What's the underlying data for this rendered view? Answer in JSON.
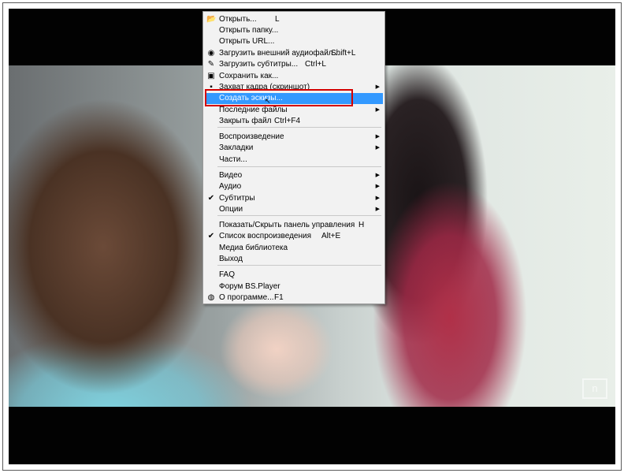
{
  "menu": {
    "items": [
      {
        "label": "Открыть...",
        "shortcut": "L",
        "icon": "open-folder-icon",
        "glyph": "📂"
      },
      {
        "label": "Открыть папку..."
      },
      {
        "label": "Открыть URL..."
      },
      {
        "label": "Загрузить внешний аудиофайл...",
        "shortcut": "Shift+L",
        "icon": "audio-file-icon",
        "glyph": "◉"
      },
      {
        "label": "Загрузить субтитры...",
        "shortcut": "Ctrl+L",
        "icon": "subtitles-pen-icon",
        "glyph": "✎"
      },
      {
        "label": "Сохранить как...",
        "icon": "save-disk-icon",
        "glyph": "▣"
      },
      {
        "label": "Захват кадра (скриншот)",
        "submenu": true,
        "icon": "camera-icon",
        "glyph": "▪"
      },
      {
        "label": "Создать эскизы...",
        "highlighted": true
      },
      {
        "label": "Последние файлы",
        "submenu": true
      },
      {
        "label": "Закрыть файл",
        "shortcut": "Ctrl+F4"
      },
      {
        "label": "Воспроизведение",
        "submenu": true
      },
      {
        "label": "Закладки",
        "submenu": true
      },
      {
        "label": "Части..."
      },
      {
        "label": "Видео",
        "submenu": true
      },
      {
        "label": "Аудио",
        "submenu": true
      },
      {
        "label": "Субтитры",
        "submenu": true,
        "icon": "subtitles-icon",
        "glyph": "✔"
      },
      {
        "label": "Опции",
        "submenu": true
      },
      {
        "label": "Показать/Скрыть панель управления",
        "shortcut": "H"
      },
      {
        "label": "Список воспроизведения",
        "shortcut": "Alt+E",
        "icon": "playlist-icon",
        "glyph": "✔"
      },
      {
        "label": "Медиа библиотека"
      },
      {
        "label": "Выход"
      },
      {
        "label": "FAQ"
      },
      {
        "label": "Форум BS.Player"
      },
      {
        "label": "О программе...",
        "shortcut": "F1",
        "icon": "about-globe-icon",
        "glyph": "◍"
      }
    ],
    "submenu_arrow": "▶"
  },
  "video": {
    "watermark": "n"
  },
  "colors": {
    "highlight": "#3399ff",
    "annotation_box": "#d40000"
  }
}
